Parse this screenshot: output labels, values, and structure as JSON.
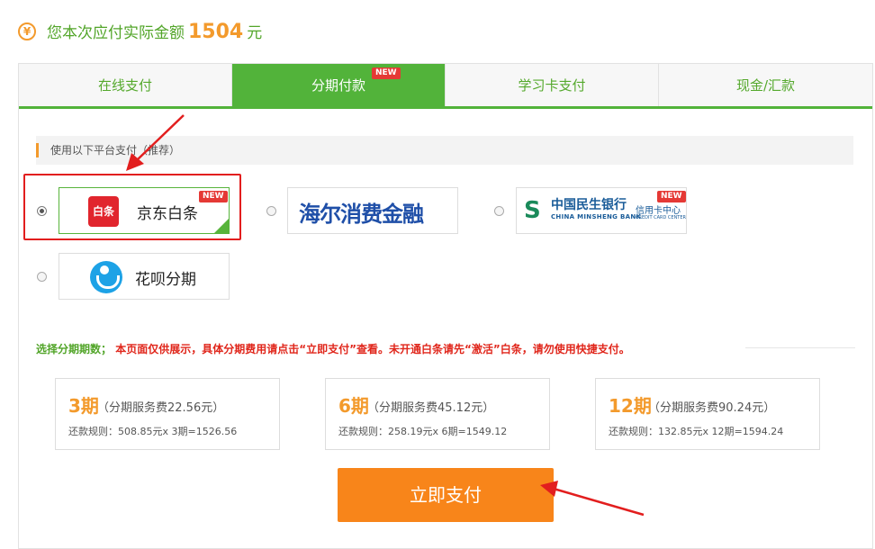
{
  "header": {
    "yen_icon": "¥",
    "prefix": "您本次应付实际金额",
    "amount": "1504",
    "unit": "元"
  },
  "tabs": [
    {
      "label": "在线支付",
      "active": false
    },
    {
      "label": "分期付款",
      "active": true,
      "badge": "NEW"
    },
    {
      "label": "学习卡支付",
      "active": false
    },
    {
      "label": "现金/汇款",
      "active": false
    }
  ],
  "platform_section": {
    "title": "使用以下平台支付（推荐）"
  },
  "platforms": [
    {
      "logo_text": "白条",
      "label": "京东白条",
      "badge": "NEW",
      "selected": true
    },
    {
      "label": "海尔消费金融",
      "selected": false
    },
    {
      "cn_name": "中国民生银行",
      "en_name": "CHINA MINSHENG BANK",
      "card_center": "信用卡中心",
      "card_center_en": "CREDIT CARD CENTER",
      "badge": "NEW",
      "selected": false
    },
    {
      "label": "花呗分期",
      "selected": false
    }
  ],
  "notice": {
    "label": "选择分期期数；",
    "text": "本页面仅供展示，具体分期费用请点击“立即支付”查看。未开通白条请先“激活”白条，请勿使用快捷支付。"
  },
  "periods": [
    {
      "term": "3期",
      "fee": "（分期服务费22.56元）",
      "rule": "还款规则：508.85元x 3期=1526.56"
    },
    {
      "term": "6期",
      "fee": "（分期服务费45.12元）",
      "rule": "还款规则：258.19元x 6期=1549.12"
    },
    {
      "term": "12期",
      "fee": "（分期服务费90.24元）",
      "rule": "还款规则：132.85元x 12期=1594.24"
    }
  ],
  "pay_button": {
    "label": "立即支付"
  },
  "colors": {
    "green": "#52b33a",
    "orange": "#f8851a",
    "red": "#e0261b",
    "accent": "#f39a2c"
  }
}
